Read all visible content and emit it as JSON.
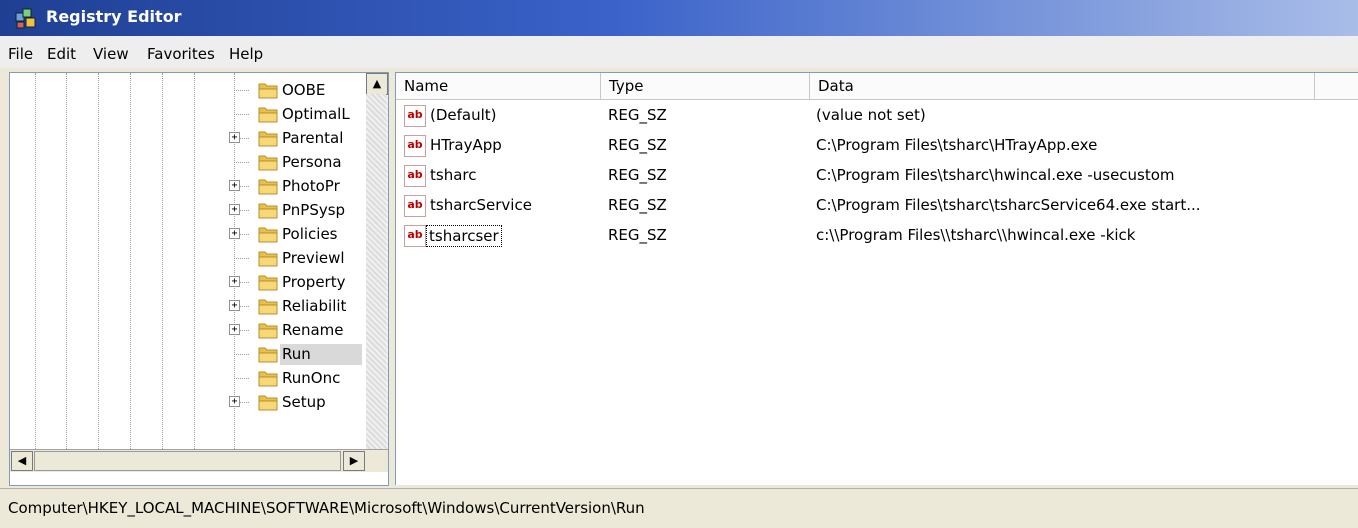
{
  "window": {
    "title": "Registry Editor"
  },
  "menu": [
    "File",
    "Edit",
    "View",
    "Favorites",
    "Help"
  ],
  "tree": {
    "items": [
      {
        "label": "OOBE",
        "expander": ""
      },
      {
        "label": "OptimalL",
        "expander": ""
      },
      {
        "label": "Parental",
        "expander": "+"
      },
      {
        "label": "Persona",
        "expander": ""
      },
      {
        "label": "PhotoPr",
        "expander": "+"
      },
      {
        "label": "PnPSysp",
        "expander": "+"
      },
      {
        "label": "Policies",
        "expander": "+"
      },
      {
        "label": "Previewl",
        "expander": ""
      },
      {
        "label": "Property",
        "expander": "+"
      },
      {
        "label": "Reliabilit",
        "expander": "+"
      },
      {
        "label": "Rename",
        "expander": "+"
      },
      {
        "label": "Run",
        "expander": "",
        "selected": true
      },
      {
        "label": "RunOnc",
        "expander": ""
      },
      {
        "label": "Setup",
        "expander": "+"
      }
    ]
  },
  "columns": {
    "name": "Name",
    "type": "Type",
    "data": "Data"
  },
  "values": [
    {
      "name": "(Default)",
      "type": "REG_SZ",
      "data": "(value not set)"
    },
    {
      "name": "HTrayApp",
      "type": "REG_SZ",
      "data": "C:\\Program Files\\tsharc\\HTrayApp.exe"
    },
    {
      "name": "tsharc",
      "type": "REG_SZ",
      "data": "C:\\Program Files\\tsharc\\hwincal.exe -usecustom"
    },
    {
      "name": "tsharcService",
      "type": "REG_SZ",
      "data": "C:\\Program Files\\tsharc\\tsharcService64.exe start..."
    },
    {
      "name": "tsharcser",
      "type": "REG_SZ",
      "data": "c:\\\\Program Files\\\\tsharc\\\\hwincal.exe -kick"
    }
  ],
  "value_icon": "ab",
  "status": {
    "path": "Computer\\HKEY_LOCAL_MACHINE\\SOFTWARE\\Microsoft\\Windows\\CurrentVersion\\Run"
  },
  "colors": {
    "titlebar": "#1f3f93",
    "folder": "#e8c04a",
    "value_icon": "#c00000"
  }
}
